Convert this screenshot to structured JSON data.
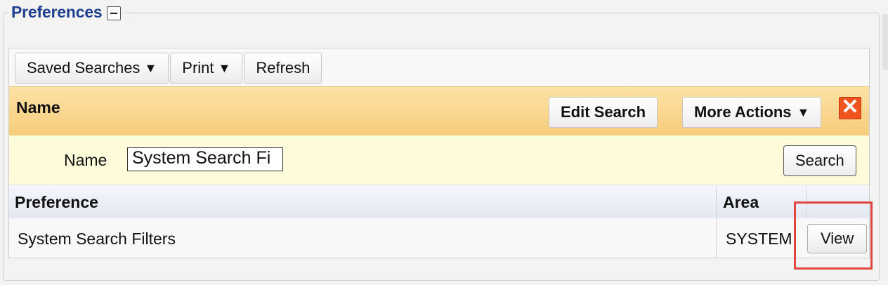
{
  "section": {
    "title": "Preferences"
  },
  "toolbar": {
    "saved_searches": "Saved Searches",
    "print": "Print",
    "refresh": "Refresh"
  },
  "name_bar": {
    "title": "Name",
    "edit_search": "Edit Search",
    "more_actions": "More Actions"
  },
  "filter": {
    "label": "Name",
    "value": "System Search Fi",
    "search_button": "Search"
  },
  "grid": {
    "columns": [
      "Preference",
      "Area"
    ],
    "rows": [
      {
        "preference": "System Search Filters",
        "area": "SYSTEM",
        "action": "View"
      }
    ]
  },
  "glyphs": {
    "caret": "▼",
    "close": "✕"
  },
  "colors": {
    "accent_title": "#1f3f8f",
    "highlight": "#e0463d",
    "close_button": "#f0531d"
  }
}
